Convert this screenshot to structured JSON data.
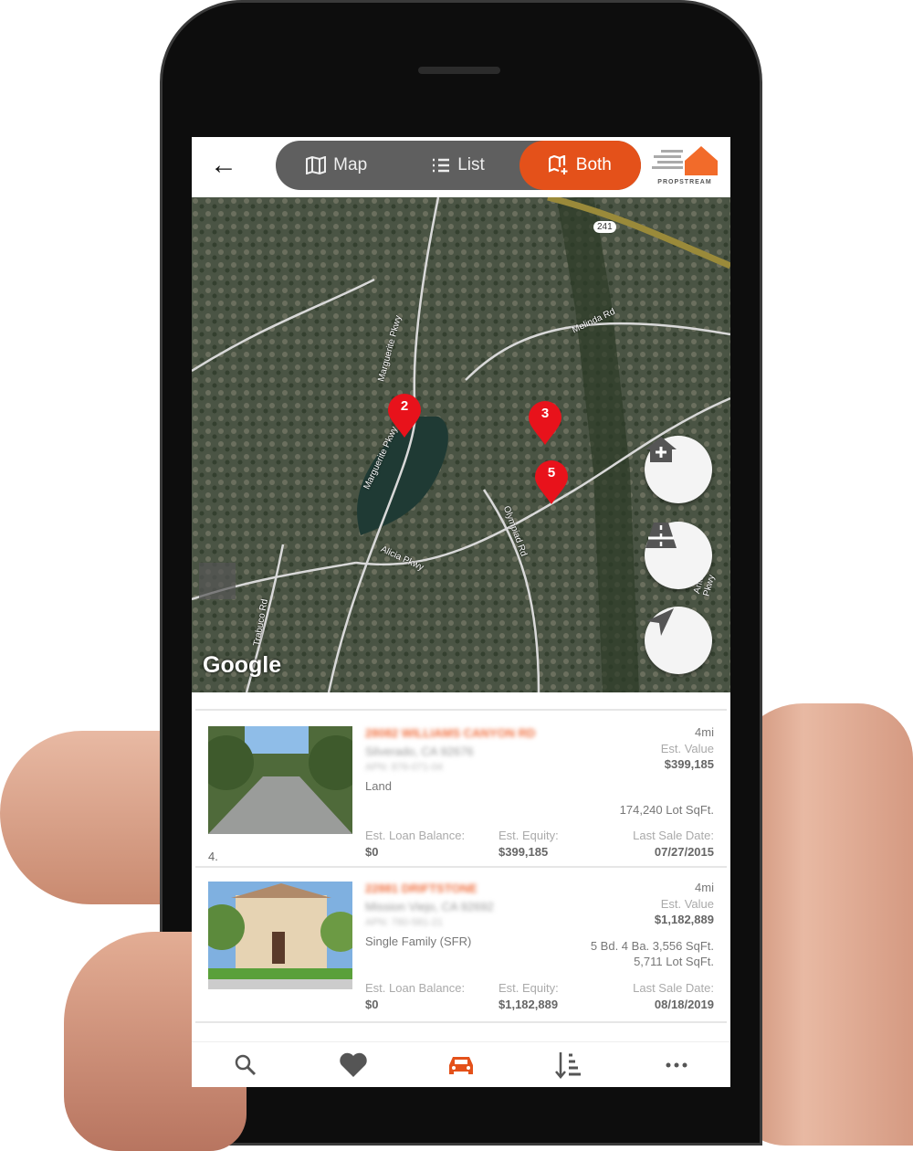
{
  "header": {
    "back_icon": "arrow-left-icon",
    "tabs": [
      {
        "label": "Map",
        "icon": "map-icon"
      },
      {
        "label": "List",
        "icon": "list-icon"
      },
      {
        "label": "Both",
        "icon": "map-plus-icon",
        "active": true
      }
    ],
    "logo_text": "PROPSTREAM"
  },
  "colors": {
    "accent": "#e4511a",
    "pin": "#e8121b"
  },
  "map": {
    "attribution": "Google",
    "labels": [
      "Marguerite Pkwy",
      "Marguerite Pkwy",
      "Melinda Rd",
      "Alicia Pkwy",
      "Olympiad Rd",
      "Trabuco Rd",
      "241",
      "Antonio Pkwy"
    ],
    "pins": [
      "2",
      "3",
      "5"
    ],
    "buttons": [
      "home-plus-icon",
      "road-icon",
      "navigation-arrow-icon"
    ]
  },
  "list": {
    "items": [
      {
        "index": "4.",
        "address": "28082 WILLIAMS CANYON RD",
        "city": "Silverado, CA 92676",
        "apn": "APN: 876-071-04",
        "type": "Land",
        "distance": "4mi",
        "est_value_label": "Est. Value",
        "est_value": "$399,185",
        "details": "",
        "lot": "174,240 Lot SqFt.",
        "loan_label": "Est. Loan Balance:",
        "loan": "$0",
        "equity_label": "Est. Equity:",
        "equity": "$399,185",
        "sale_label": "Last Sale Date:",
        "sale": "07/27/2015"
      },
      {
        "index": "",
        "address": "22881 DRIFTSTONE",
        "city": "Mission Viejo, CA 92692",
        "apn": "APN: 780-581-21",
        "type": "Single Family (SFR)",
        "distance": "4mi",
        "est_value_label": "Est. Value",
        "est_value": "$1,182,889",
        "details": "5 Bd. 4 Ba. 3,556 SqFt.",
        "lot": "5,711 Lot SqFt.",
        "loan_label": "Est. Loan Balance:",
        "loan": "$0",
        "equity_label": "Est. Equity:",
        "equity": "$1,182,889",
        "sale_label": "Last Sale Date:",
        "sale": "08/18/2019"
      }
    ]
  },
  "nav": [
    {
      "icon": "search-icon"
    },
    {
      "icon": "heart-icon"
    },
    {
      "icon": "car-icon",
      "active": true
    },
    {
      "icon": "sort-icon"
    },
    {
      "icon": "more-icon"
    }
  ]
}
